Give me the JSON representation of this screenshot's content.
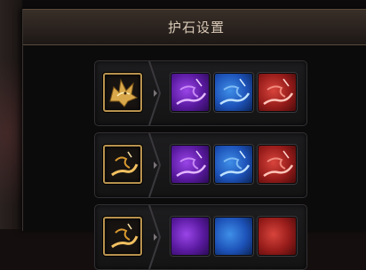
{
  "panel": {
    "title": "护石设置"
  },
  "rows": [
    {
      "base_icon": "golden-dragon-head-icon",
      "gem_icons": [
        "purple-talisman-icon",
        "blue-talisman-icon",
        "red-talisman-icon"
      ]
    },
    {
      "base_icon": "golden-claw-talisman-icon",
      "gem_icons": [
        "purple-talisman-icon",
        "blue-talisman-icon",
        "red-talisman-icon"
      ]
    },
    {
      "base_icon": "golden-claw-talisman-icon",
      "gem_icons": [
        "purple-talisman-icon",
        "blue-talisman-icon",
        "red-talisman-icon"
      ]
    }
  ],
  "colors": {
    "base_frame": "#b8924e",
    "purple": "#7d2fd0",
    "blue": "#2a6fd8",
    "red": "#b92b26",
    "title_text": "#d8c9b6"
  }
}
